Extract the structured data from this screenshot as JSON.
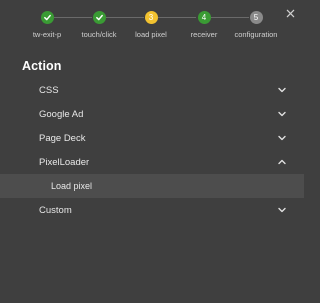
{
  "stepper": {
    "steps": [
      {
        "label": "tw-exit-p",
        "status": "complete",
        "marker": ""
      },
      {
        "label": "touch/click",
        "status": "complete",
        "marker": ""
      },
      {
        "label": "load pixel",
        "status": "current",
        "marker": "3"
      },
      {
        "label": "receiver",
        "status": "pending",
        "marker": "4"
      },
      {
        "label": "configuration",
        "status": "disabled",
        "marker": "5"
      }
    ],
    "colors": {
      "complete": "#3a9b34",
      "current": "#f2c230",
      "pending": "#3a9b34",
      "disabled": "#8a8a8a"
    }
  },
  "header": {
    "close_icon": "close-icon"
  },
  "section": {
    "title": "Action"
  },
  "accordion": {
    "items": [
      {
        "label": "CSS",
        "expanded": false
      },
      {
        "label": "Google Ad",
        "expanded": false
      },
      {
        "label": "Page Deck",
        "expanded": false
      },
      {
        "label": "PixelLoader",
        "expanded": true,
        "children": [
          {
            "label": "Load pixel"
          }
        ]
      },
      {
        "label": "Custom",
        "expanded": false
      }
    ]
  }
}
